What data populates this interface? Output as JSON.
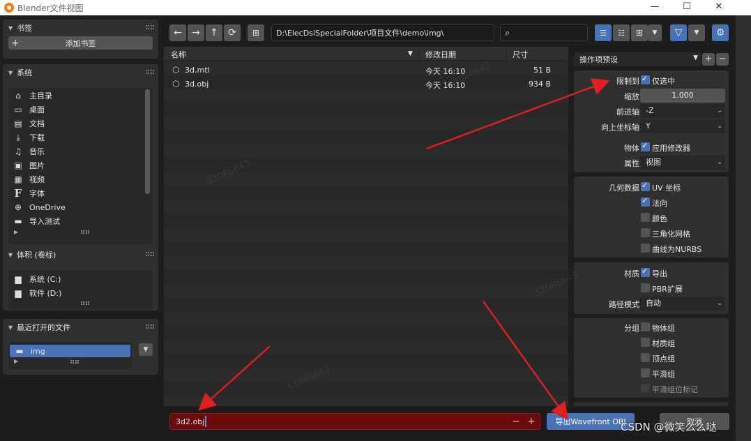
{
  "window": {
    "title": "Blender文件视图",
    "controls": [
      "—",
      "☐",
      "✕"
    ]
  },
  "sidebar": {
    "bookmarks": {
      "title": "书签",
      "add_label": "添加书签"
    },
    "system": {
      "title": "系统",
      "items": [
        {
          "label": "主目录",
          "icon": "home-icon"
        },
        {
          "label": "桌面",
          "icon": "desktop-icon"
        },
        {
          "label": "文档",
          "icon": "document-icon"
        },
        {
          "label": "下载",
          "icon": "download-icon"
        },
        {
          "label": "音乐",
          "icon": "music-icon"
        },
        {
          "label": "图片",
          "icon": "image-icon"
        },
        {
          "label": "视频",
          "icon": "video-icon"
        },
        {
          "label": "字体",
          "icon": "font-icon"
        },
        {
          "label": "OneDrive",
          "icon": "network-icon"
        },
        {
          "label": "导入测试",
          "icon": "folder-icon"
        }
      ]
    },
    "volumes": {
      "title": "体积 (卷标)",
      "items": [
        {
          "label": "系统 (C:)",
          "icon": "disk-icon"
        },
        {
          "label": "软件 (D:)",
          "icon": "disk-icon"
        }
      ]
    },
    "recent": {
      "title": "最近打开的文件",
      "items": [
        {
          "label": "img",
          "icon": "folder-icon"
        }
      ]
    }
  },
  "toolbar": {
    "path": "D:\\ElecDsiSpecialFolder\\项目文件\\demo\\img\\",
    "search_placeholder": ""
  },
  "filelist": {
    "columns": {
      "name": "名称",
      "date": "修改日期",
      "size": "尺寸"
    },
    "files": [
      {
        "name": "3d.mtl",
        "date": "今天 16:10",
        "size": "51 B"
      },
      {
        "name": "3d.obj",
        "date": "今天 16:10",
        "size": "934 B"
      }
    ]
  },
  "bottom": {
    "filename": "3d2.obj",
    "export_label": "导出Wavefront OBJ",
    "cancel_label": "取消"
  },
  "options": {
    "preset_label": "操作项预设",
    "limit_to": {
      "label": "限制到",
      "value": "仅选中",
      "checked": true
    },
    "scale": {
      "label": "缩放",
      "value": "1.000"
    },
    "forward_axis": {
      "label": "前进轴",
      "value": "-Z"
    },
    "up_axis": {
      "label": "向上坐标轴",
      "value": "Y"
    },
    "object": {
      "label": "物体",
      "value": "应用修改器",
      "checked": true
    },
    "properties": {
      "label": "属性",
      "value": "视图"
    },
    "geometry": {
      "label": "几何数据",
      "items": [
        {
          "label": "UV 坐标",
          "checked": true
        },
        {
          "label": "法向",
          "checked": true
        },
        {
          "label": "颜色",
          "checked": false
        },
        {
          "label": "三角化网格",
          "checked": false
        },
        {
          "label": "曲线为NURBS",
          "checked": false
        }
      ]
    },
    "materials": {
      "label": "材质",
      "items": [
        {
          "label": "导出",
          "checked": true
        },
        {
          "label": "PBR扩展",
          "checked": false
        }
      ]
    },
    "path_mode": {
      "label": "路径模式",
      "value": "自动"
    },
    "grouping": {
      "label": "分组",
      "items": [
        {
          "label": "物体组",
          "checked": false
        },
        {
          "label": "材质组",
          "checked": false
        },
        {
          "label": "顶点组",
          "checked": false
        },
        {
          "label": "平滑组",
          "checked": false
        },
        {
          "label": "平滑组位标记",
          "checked": false
        }
      ]
    }
  },
  "watermarks": [
    "S1086643",
    "S1086643",
    "S1086643",
    "S1086643"
  ],
  "csdn_watermark": "CSDN @微笑么么哒",
  "colors": {
    "accent": "#4772b3",
    "filename_bg": "#6b0a0a",
    "arrow": "#e02020"
  }
}
